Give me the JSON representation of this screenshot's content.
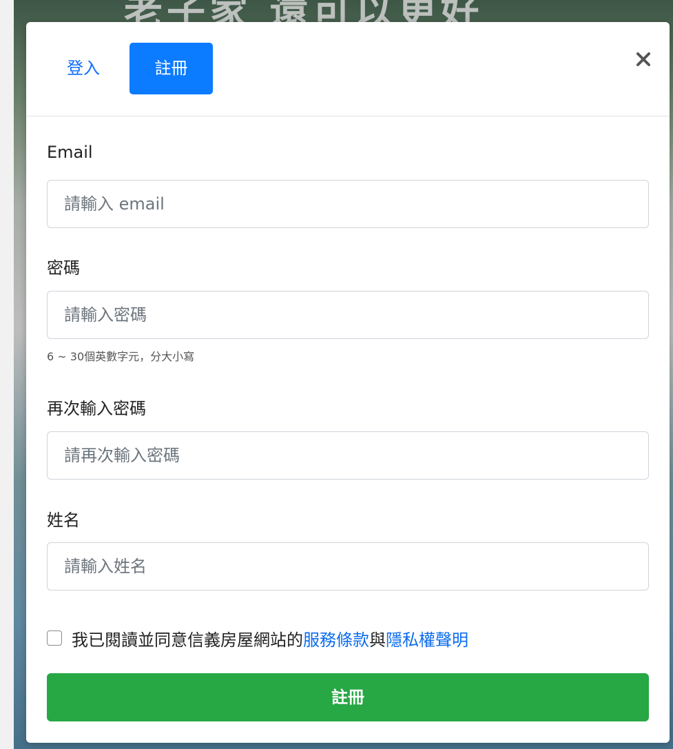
{
  "background": {
    "headline": "老子家 還可以更好"
  },
  "header": {
    "tabs": [
      {
        "label": "登入",
        "active": false
      },
      {
        "label": "註冊",
        "active": true
      }
    ],
    "close_label": "close"
  },
  "form": {
    "email": {
      "label": "Email",
      "placeholder": "請輸入 email",
      "value": ""
    },
    "password": {
      "label": "密碼",
      "placeholder": "請輸入密碼",
      "value": "",
      "hint": "6 ~ 30個英數字元，分大小寫"
    },
    "confirm_password": {
      "label": "再次輸入密碼",
      "placeholder": "請再次輸入密碼",
      "value": ""
    },
    "name": {
      "label": "姓名",
      "placeholder": "請輸入姓名",
      "value": ""
    },
    "agreement": {
      "prefix": "我已閱讀並同意信義房屋網站的",
      "terms_link": "服務條款",
      "conjunction": "與",
      "privacy_link": "隱私權聲明",
      "checked": false
    },
    "submit_label": "註冊"
  },
  "colors": {
    "primary": "#0b7bff",
    "success": "#28a745",
    "link": "#0b6cf0"
  }
}
